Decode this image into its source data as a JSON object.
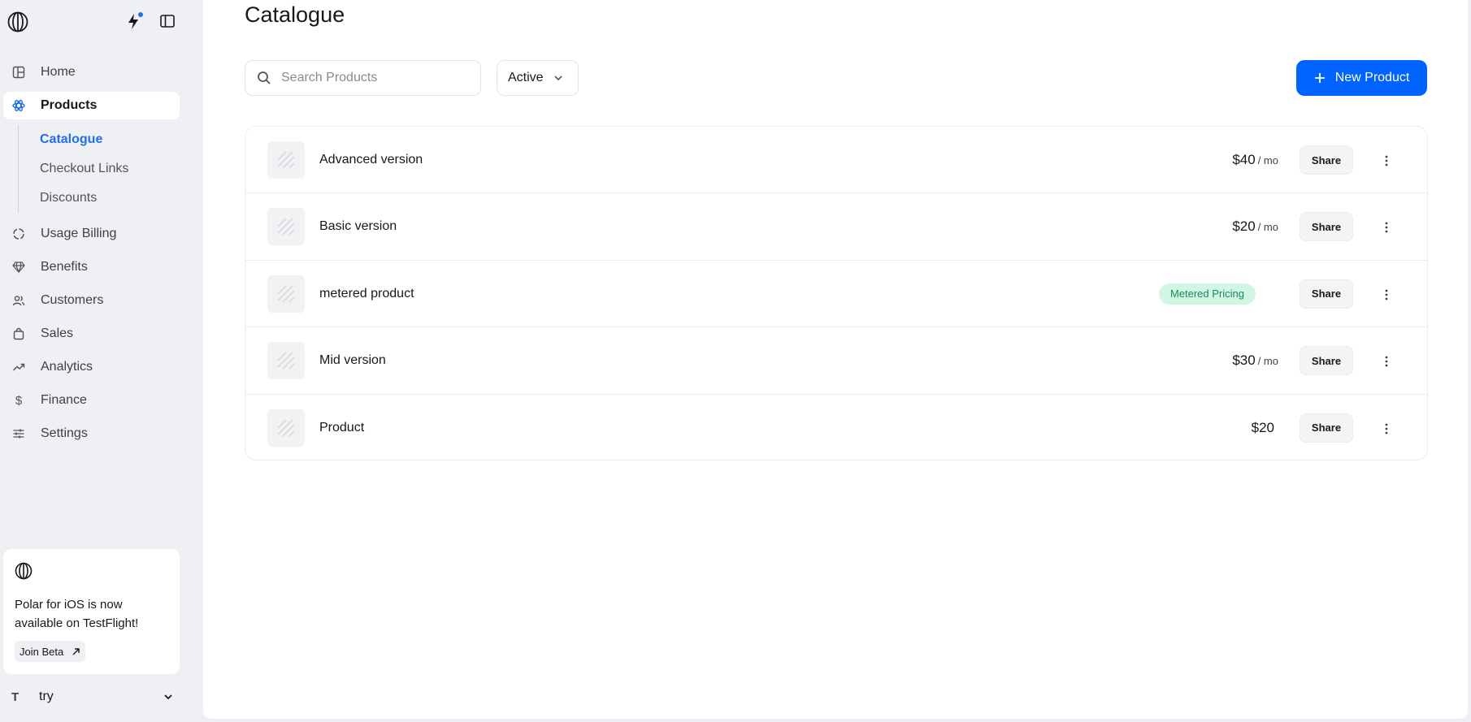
{
  "sidebar": {
    "nav": [
      {
        "label": "Home",
        "icon": "grid-icon"
      },
      {
        "label": "Products",
        "icon": "atom-icon",
        "active": true
      },
      {
        "label": "Usage Billing",
        "icon": "circle-dashed-icon"
      },
      {
        "label": "Benefits",
        "icon": "diamond-icon"
      },
      {
        "label": "Customers",
        "icon": "users-icon"
      },
      {
        "label": "Sales",
        "icon": "shopping-bag-icon"
      },
      {
        "label": "Analytics",
        "icon": "trending-up-icon"
      },
      {
        "label": "Finance",
        "icon": "dollar-icon"
      },
      {
        "label": "Settings",
        "icon": "sliders-icon"
      }
    ],
    "products_sub": [
      {
        "label": "Catalogue",
        "active": true
      },
      {
        "label": "Checkout Links"
      },
      {
        "label": "Discounts"
      }
    ],
    "promo": {
      "text": "Polar for iOS is now available on TestFlight!",
      "button": "Join Beta"
    },
    "account": {
      "initial": "T",
      "name": "try"
    }
  },
  "main": {
    "title": "Catalogue",
    "search_placeholder": "Search Products",
    "filter_value": "Active",
    "new_button": "New Product",
    "products": [
      {
        "name": "Advanced version",
        "price": "$40",
        "period": "/ mo",
        "share": "Share"
      },
      {
        "name": "Basic version",
        "price": "$20",
        "period": "/ mo",
        "share": "Share"
      },
      {
        "name": "metered product",
        "badge": "Metered Pricing",
        "share": "Share"
      },
      {
        "name": "Mid version",
        "price": "$30",
        "period": "/ mo",
        "share": "Share"
      },
      {
        "name": "Product",
        "price": "$20",
        "share": "Share"
      }
    ]
  },
  "colors": {
    "accent": "#0062ff",
    "active_nav": "#1f6feb",
    "badge_bg": "#d3f6e4",
    "badge_text": "#148a55"
  }
}
